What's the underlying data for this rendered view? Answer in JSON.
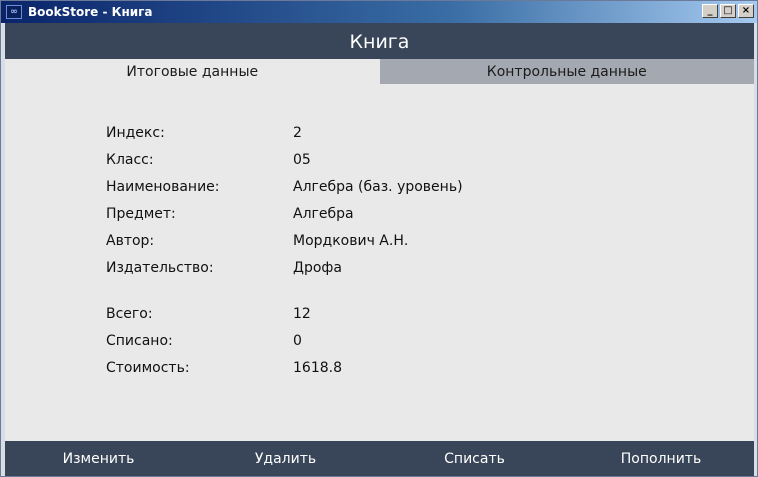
{
  "window": {
    "title": "BookStore - Книга",
    "icon": "app-logo-icon",
    "controls": {
      "minimize": "_",
      "maximize": "□",
      "close": "×"
    }
  },
  "header": {
    "title": "Книга"
  },
  "tabs": [
    {
      "label": "Итоговые данные",
      "active": true
    },
    {
      "label": "Контрольные данные",
      "active": false
    }
  ],
  "fields": [
    {
      "label": "Индекс:",
      "value": "2"
    },
    {
      "label": "Класс:",
      "value": "05"
    },
    {
      "label": "Наименование:",
      "value": "Алгебра (баз. уровень)"
    },
    {
      "label": "Предмет:",
      "value": "Алгебра"
    },
    {
      "label": "Автор:",
      "value": "Мордкович А.Н."
    },
    {
      "label": "Издательство:",
      "value": "Дрофа"
    }
  ],
  "totals": [
    {
      "label": "Всего:",
      "value": "12"
    },
    {
      "label": "Списано:",
      "value": "0"
    },
    {
      "label": "Стоимость:",
      "value": "1618.8"
    }
  ],
  "footer": {
    "buttons": [
      "Изменить",
      "Удалить",
      "Списать",
      "Пополнить"
    ]
  },
  "colors": {
    "header_bg": "#394558",
    "tab_inactive_bg": "#a4a8b0",
    "content_bg": "#e9e9e9"
  }
}
